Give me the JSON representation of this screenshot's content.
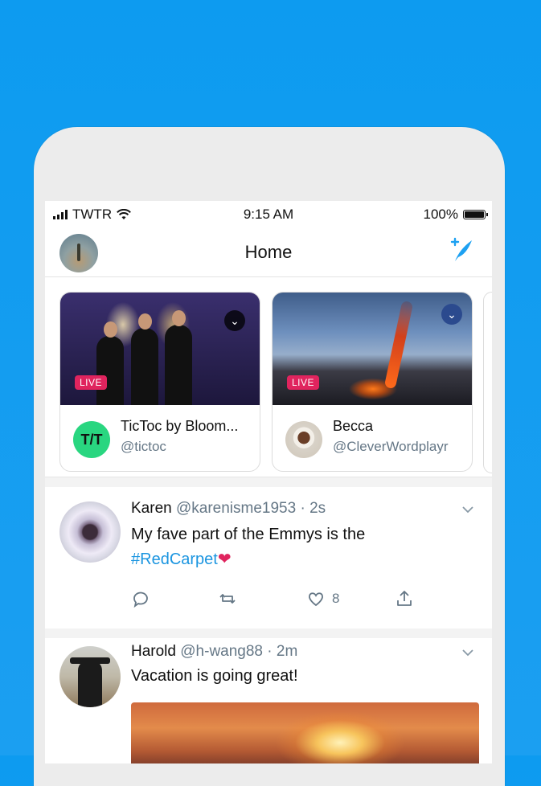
{
  "status_bar": {
    "carrier": "TWTR",
    "time": "9:15 AM",
    "battery_text": "100%",
    "battery_level": 1.0
  },
  "nav": {
    "title": "Home",
    "compose_icon": "compose-tweet-icon"
  },
  "stories": [
    {
      "live_label": "LIVE",
      "name": "TicToc by Bloom...",
      "handle": "@tictoc",
      "avatar_text": "T/T"
    },
    {
      "live_label": "LIVE",
      "name": "Becca",
      "handle": "@CleverWordplayr"
    }
  ],
  "tweets": [
    {
      "name": "Karen",
      "handle": "@karenisme1953",
      "time": "· 2s",
      "text": "My fave part of the Emmys is the",
      "hashtag": "#RedCarpet",
      "emoji": "❤",
      "likes": "8"
    },
    {
      "name": "Harold",
      "handle": "@h-wang88",
      "time": "· 2m",
      "text": "Vacation is going great!"
    }
  ],
  "colors": {
    "background": "#1da1f2",
    "accent": "#1b95e0",
    "live": "#e0245e"
  }
}
